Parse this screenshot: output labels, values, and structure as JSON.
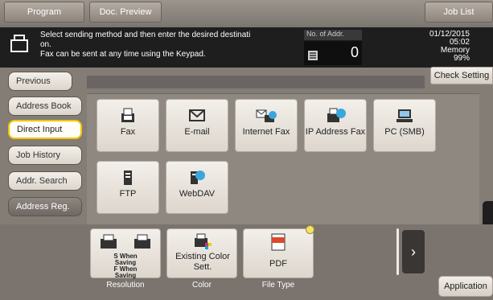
{
  "header": {
    "program_tab": "Program",
    "doc_preview_tab": "Doc. Preview",
    "job_list_tab": "Job List"
  },
  "message": {
    "line1": "Select sending method and then enter the desired destinati",
    "line2": "on.",
    "line3": "Fax can be sent at any time using the Keypad.",
    "count_label": "No. of Addr.",
    "count_value": "0"
  },
  "status": {
    "date": "01/12/2015",
    "time": "05:02",
    "memory_label": "Memory",
    "memory_value": "99%"
  },
  "nav": {
    "previous": "Previous",
    "address_book": "Address Book",
    "direct_input": "Direct Input",
    "job_history": "Job History",
    "addr_search": "Addr. Search",
    "address_reg": "Address Reg."
  },
  "check_setting": "Check Setting",
  "send_methods": {
    "fax": "Fax",
    "email": "E-mail",
    "internet_fax": "Internet Fax",
    "ip_address_fax": "IP Address Fax",
    "pc_smb": "PC (SMB)",
    "ftp": "FTP",
    "webdav": "WebDAV"
  },
  "settings": {
    "resolution_line1": "S When",
    "resolution_line2": "Saving",
    "resolution_line3": "F When",
    "resolution_line4": "Saving",
    "resolution_label": "Resolution",
    "color_value": "Existing Color Sett.",
    "color_label": "Color",
    "file_type_value": "PDF",
    "file_type_label": "File Type"
  },
  "application": "Application",
  "colors": {
    "accent": "#f4c400"
  }
}
